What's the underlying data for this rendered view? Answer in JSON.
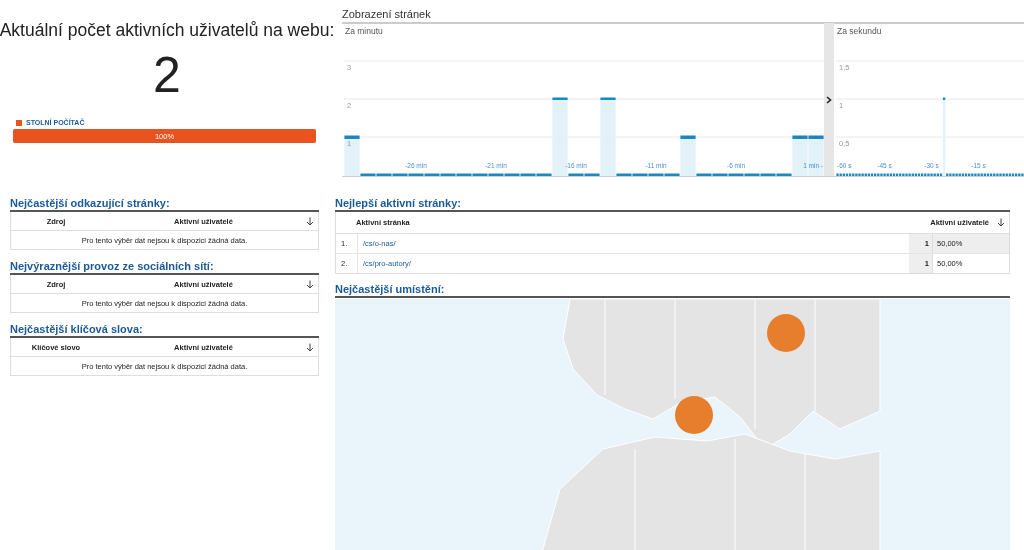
{
  "active_users": {
    "title": "Aktuální počet aktivních uživatelů na webu:",
    "count": "2"
  },
  "devices": [
    {
      "label": "STOLNÍ POČÍTAČ",
      "color": "#e8531f",
      "level": 1,
      "reading": "100%"
    }
  ],
  "pageviews": {
    "title": "Zobrazení stránek",
    "per_minute": {
      "label": "Za minutu",
      "chart_data": {
        "type": "bar",
        "x": [
          -30,
          -29,
          -28,
          -27,
          -26,
          -25,
          -24,
          -23,
          -22,
          -21,
          -20,
          -19,
          -18,
          -17,
          -16,
          -15,
          -14,
          -13,
          -12,
          -11,
          -10,
          -9,
          -8,
          -7,
          -6,
          -5,
          -4,
          -3,
          -2,
          -1
        ],
        "values": [
          1,
          0,
          0,
          0,
          0,
          0,
          0,
          0,
          0,
          0,
          0,
          0,
          0,
          2,
          0,
          0,
          2,
          0,
          0,
          0,
          0,
          1,
          0,
          0,
          0,
          0,
          0,
          0,
          1,
          1
        ],
        "xlim": [
          -30.5,
          -0.5
        ],
        "ylim": [
          0,
          4
        ],
        "yticks": [
          1,
          2,
          3
        ],
        "grid": true,
        "xticks": [
          {
            "value": -26,
            "label": "-26 min"
          },
          {
            "value": -21,
            "label": "-21 min"
          },
          {
            "value": -16,
            "label": "-16 min"
          },
          {
            "value": -11,
            "label": "-11 min"
          },
          {
            "value": -6,
            "label": "-6 min"
          },
          {
            "value": -1,
            "label": "1 min -"
          }
        ]
      }
    },
    "per_second": {
      "label": "Za sekundu",
      "chart_data": {
        "type": "bar",
        "x": [
          -60,
          -59,
          -58,
          -57,
          -56,
          -55,
          -54,
          -53,
          -52,
          -51,
          -50,
          -49,
          -48,
          -47,
          -46,
          -45,
          -44,
          -43,
          -42,
          -41,
          -40,
          -39,
          -38,
          -37,
          -36,
          -35,
          -34,
          -33,
          -32,
          -31,
          -30,
          -29,
          -28,
          -27,
          -26,
          -25,
          -24,
          -23,
          -22,
          -21,
          -20,
          -19,
          -18,
          -17,
          -16,
          -15,
          -14,
          -13,
          -12,
          -11,
          -10,
          -9,
          -8,
          -7,
          -6,
          -5,
          -4,
          -3,
          -2,
          -1
        ],
        "values": [
          0,
          0,
          0,
          0,
          0,
          0,
          0,
          0,
          0,
          0,
          0,
          0,
          0,
          0,
          0,
          0,
          0,
          0,
          0,
          0,
          0,
          0,
          0,
          0,
          0,
          0,
          0,
          0,
          0,
          0,
          0,
          0,
          0,
          0,
          1,
          0,
          0,
          0,
          0,
          0,
          0,
          0,
          0,
          0,
          0,
          0,
          0,
          0,
          0,
          0,
          0,
          0,
          0,
          0,
          0,
          0,
          0,
          0,
          0,
          0
        ],
        "xlim": [
          -60.5,
          -0.5
        ],
        "ylim": [
          0,
          2
        ],
        "grid": true,
        "yticks": [
          {
            "value": 0.5,
            "label": "0,5"
          },
          {
            "value": 1,
            "label": "1"
          },
          {
            "value": 1.5,
            "label": "1,5"
          }
        ],
        "xticks": [
          {
            "value": -60,
            "label": "-60 s"
          },
          {
            "value": -45,
            "label": "-45 s"
          },
          {
            "value": -30,
            "label": "-30 s"
          },
          {
            "value": -15,
            "label": "-15 s"
          }
        ]
      }
    }
  },
  "left_tables": [
    {
      "title": "Nejčastější odkazující stránky:",
      "columns": [
        "Zdroj",
        "Aktivní uživatelé"
      ],
      "empty_message": "Pro tento výběr dat nejsou k dispozici žádná data."
    },
    {
      "title": "Nejvýraznější provoz ze sociálních sítí:",
      "columns": [
        "Zdroj",
        "Aktivní uživatelé"
      ],
      "empty_message": "Pro tento výběr dat nejsou k dispozici žádná data."
    },
    {
      "title": "Nejčastější klíčová slova:",
      "columns": [
        "Klíčové slovo",
        "Aktivní uživatelé"
      ],
      "empty_message": "Pro tento výběr dat nejsou k dispozici žádná data."
    }
  ],
  "top_pages": {
    "title": "Nejlepší aktivní stránky:",
    "columns": [
      "Aktivní stránka",
      "Aktivní uživatelé"
    ],
    "rows": [
      {
        "rank": "1.",
        "page": "/cs/o-nas/",
        "users": "1",
        "share": "50,00%"
      },
      {
        "rank": "2.",
        "page": "/cs/pro-autory/",
        "users": "1",
        "share": "50,00%"
      }
    ]
  },
  "locations": {
    "title": "Nejčastější umístění:"
  }
}
